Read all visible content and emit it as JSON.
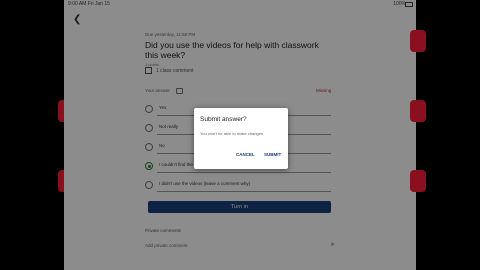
{
  "status_bar": {
    "time": "9:00 AM  Fri Jan 15",
    "battery": "100%"
  },
  "assignment": {
    "due": "Due yesterday, 11:59 PM",
    "question": "Did you use the videos for help with classwork this week?",
    "points": "1 points",
    "class_comment": "1 class comment"
  },
  "answer": {
    "header": "Your answer",
    "status": "Missing",
    "options": [
      {
        "label": "Yes",
        "selected": false
      },
      {
        "label": "Not really",
        "selected": false
      },
      {
        "label": "No",
        "selected": false
      },
      {
        "label": "I couldn't find the videos",
        "selected": true
      },
      {
        "label": "I didn't use the videos (leave a comment why)",
        "selected": false
      }
    ]
  },
  "turn_in_label": "Turn in",
  "private_comments": {
    "label": "Private comments",
    "placeholder": "Add private comment"
  },
  "dialog": {
    "title": "Submit answer?",
    "body": "You won't be able to make changes",
    "cancel": "CANCEL",
    "submit": "SUBMIT"
  },
  "colors": {
    "accent": "#1a3e7a",
    "missing": "#c62828",
    "selected": "#2e7d32"
  }
}
